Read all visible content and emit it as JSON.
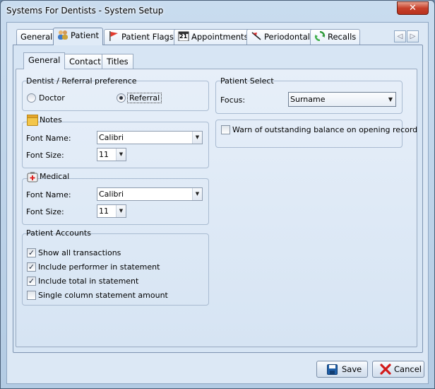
{
  "window": {
    "title": "Systems For Dentists - System Setup",
    "close_glyph": "✕"
  },
  "main_tabs": [
    {
      "label": "General",
      "icon": "none"
    },
    {
      "label": "Patient",
      "icon": "people-icon"
    },
    {
      "label": "Patient Flags",
      "icon": "red-flag-icon"
    },
    {
      "label": "Appointments",
      "icon": "calendar-icon",
      "icon_text": "21"
    },
    {
      "label": "Periodontal",
      "icon": "tooth-chart-icon"
    },
    {
      "label": "Recalls",
      "icon": "recycle-icon"
    }
  ],
  "tab_nav": {
    "prev_glyph": "◁",
    "next_glyph": "▷"
  },
  "sub_tabs": [
    {
      "label": "General"
    },
    {
      "label": "Contact"
    },
    {
      "label": "Titles"
    }
  ],
  "dentist_referral": {
    "title": "Dentist / Referral preference",
    "options": [
      {
        "label": "Doctor",
        "selected": false
      },
      {
        "label": "Referral",
        "selected": true
      }
    ]
  },
  "notes": {
    "title": "Notes",
    "font_name_label": "Font Name:",
    "font_name_value": "Calibri",
    "font_size_label": "Font Size:",
    "font_size_value": "11"
  },
  "medical": {
    "title": "Medical",
    "font_name_label": "Font Name:",
    "font_name_value": "Calibri",
    "font_size_label": "Font Size:",
    "font_size_value": "11"
  },
  "patient_accounts": {
    "title": "Patient Accounts",
    "items": [
      {
        "label": "Show all transactions",
        "checked": true
      },
      {
        "label": "Include performer in statement",
        "checked": true
      },
      {
        "label": "Include total in statement",
        "checked": true
      },
      {
        "label": "Single column statement amount",
        "checked": false
      }
    ]
  },
  "patient_select": {
    "title": "Patient Select",
    "focus_label": "Focus:",
    "focus_value": "Surname"
  },
  "warn_balance": {
    "label": "Warn of outstanding balance on opening record",
    "checked": false
  },
  "buttons": {
    "save": "Save",
    "cancel": "Cancel"
  },
  "check_glyph": "✓",
  "dropdown_glyph": "▼",
  "colors": {
    "save_icon": "#1f5fa8",
    "cancel_icon": "#d21a1a",
    "flag": "#e23b2e"
  }
}
